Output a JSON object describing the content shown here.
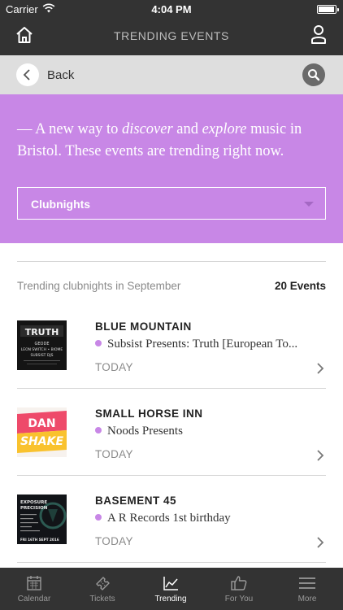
{
  "status_bar": {
    "carrier": "Carrier",
    "time": "4:04 PM"
  },
  "nav": {
    "title": "TRENDING EVENTS"
  },
  "back_bar": {
    "back_label": "Back"
  },
  "hero": {
    "intro_prefix": "— A new way to ",
    "intro_discover": "discover",
    "intro_and": " and ",
    "intro_explore": "explore",
    "intro_suffix": " music in Bristol. These events are trending right now.",
    "dropdown_value": "Clubnights",
    "background_color": "#c887e6"
  },
  "section": {
    "label": "Trending clubnights in September",
    "count": "20 Events"
  },
  "events": [
    {
      "venue": "BLUE MOUNTAIN",
      "name": "Subsist Presents: Truth [European To...",
      "when": "TODAY",
      "poster": {
        "title": "TRUTH",
        "lines": [
          "GEODE",
          "LEON SWITCH • BIOME",
          "SUBSIST DJS"
        ]
      }
    },
    {
      "venue": "SMALL HORSE INN",
      "name": "Noods Presents",
      "when": "TODAY",
      "poster": {
        "line1": "DAN",
        "line2": "SHAKE"
      }
    },
    {
      "venue": "BASEMENT 45",
      "name": "A R Records 1st birthday",
      "when": "TODAY",
      "poster": {
        "line1": "EXPOSURE",
        "line2": "PRECISION",
        "footer": "FRI 16TH SEPT 2016"
      }
    }
  ],
  "tabs": [
    {
      "label": "Calendar",
      "icon": "calendar-icon",
      "active": false
    },
    {
      "label": "Tickets",
      "icon": "ticket-icon",
      "active": false
    },
    {
      "label": "Trending",
      "icon": "trending-chart-icon",
      "active": true
    },
    {
      "label": "For You",
      "icon": "thumbs-up-icon",
      "active": false
    },
    {
      "label": "More",
      "icon": "menu-icon",
      "active": false
    }
  ],
  "colors": {
    "header": "#333333",
    "accent": "#c887e6",
    "back_bar": "#dedede"
  }
}
